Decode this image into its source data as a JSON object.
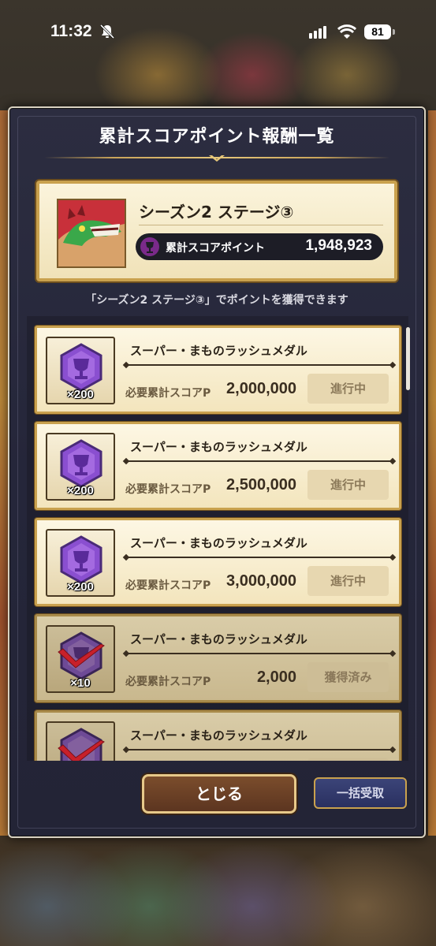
{
  "status_bar": {
    "time": "11:32",
    "battery": "81"
  },
  "dialog": {
    "title": "累計スコアポイント報酬一覧",
    "stage": {
      "name": "シーズン2 ステージ③",
      "score_label": "累計スコアポイント",
      "score_value": "1,948,923"
    },
    "hint": "「シーズン2 ステージ③」でポイントを獲得できます",
    "rewards": [
      {
        "name": "スーパー・まものラッシュメダル",
        "qty": "×200",
        "req_label": "必要累計スコアP",
        "req_value": "2,000,000",
        "status": "進行中"
      },
      {
        "name": "スーパー・まものラッシュメダル",
        "qty": "×200",
        "req_label": "必要累計スコアP",
        "req_value": "2,500,000",
        "status": "進行中"
      },
      {
        "name": "スーパー・まものラッシュメダル",
        "qty": "×200",
        "req_label": "必要累計スコアP",
        "req_value": "3,000,000",
        "status": "進行中"
      },
      {
        "name": "スーパー・まものラッシュメダル",
        "qty": "×10",
        "req_label": "必要累計スコアP",
        "req_value": "2,000",
        "status": "獲得済み"
      },
      {
        "name": "スーパー・まものラッシュメダル",
        "qty": "",
        "req_label": "",
        "req_value": "",
        "status": ""
      }
    ],
    "close_button": "とじる",
    "claim_all_button": "一括受取"
  },
  "colors": {
    "medal": "#8a4fd0",
    "check": "#c8202a",
    "panel": "#25263a",
    "gold": "#c9a14e"
  }
}
